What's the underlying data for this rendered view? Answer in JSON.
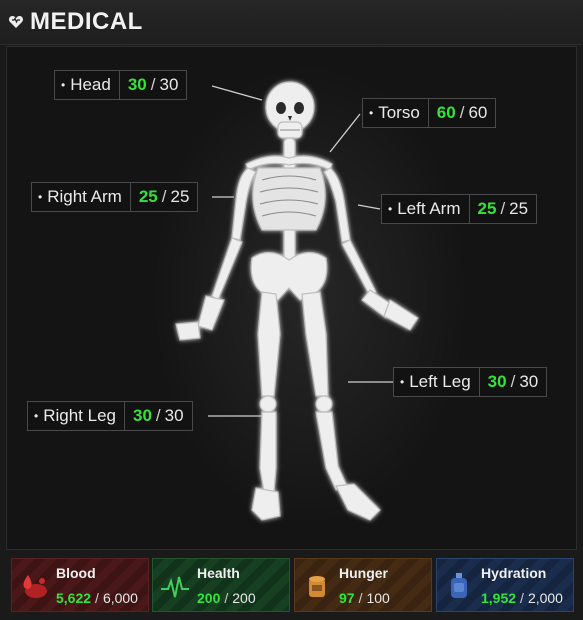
{
  "header": {
    "title": "MEDICAL",
    "icon": "heart-icon"
  },
  "body_parts": [
    {
      "key": "head",
      "bullet": "•",
      "label": "Head",
      "current": "30",
      "max": "30"
    },
    {
      "key": "torso",
      "bullet": "•",
      "label": "Torso",
      "current": "60",
      "max": "60"
    },
    {
      "key": "right_arm",
      "bullet": "•",
      "label": "Right Arm",
      "current": "25",
      "max": "25"
    },
    {
      "key": "left_arm",
      "bullet": "•",
      "label": "Left Arm",
      "current": "25",
      "max": "25"
    },
    {
      "key": "left_leg",
      "bullet": "•",
      "label": "Left Leg",
      "current": "30",
      "max": "30"
    },
    {
      "key": "right_leg",
      "bullet": "•",
      "label": "Right Leg",
      "current": "30",
      "max": "30"
    }
  ],
  "separator": "/",
  "stats": [
    {
      "label": "Blood",
      "current": "5,622",
      "max": "6,000",
      "icon": "blood-drop-icon",
      "color": "#c03030"
    },
    {
      "label": "Health",
      "current": "200",
      "max": "200",
      "icon": "heartbeat-icon",
      "color": "#2e9e46"
    },
    {
      "label": "Hunger",
      "current": "97",
      "max": "100",
      "icon": "food-can-icon",
      "color": "#c97a2a"
    },
    {
      "label": "Hydration",
      "current": "1,952",
      "max": "2,000",
      "icon": "canteen-icon",
      "color": "#3a64b8"
    }
  ],
  "colors": {
    "value_green": "#32e43a",
    "background": "#161616"
  }
}
